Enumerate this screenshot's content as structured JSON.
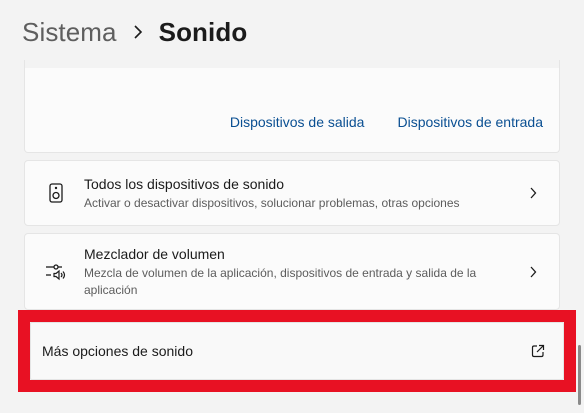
{
  "breadcrumb": {
    "parent": "Sistema",
    "current": "Sonido"
  },
  "device_links": {
    "output": "Dispositivos de salida",
    "input": "Dispositivos de entrada"
  },
  "rows": {
    "all_devices": {
      "title": "Todos los dispositivos de sonido",
      "subtitle": "Activar o desactivar dispositivos, solucionar problemas, otras opciones",
      "icon": "speaker-icon"
    },
    "mixer": {
      "title": "Mezclador de volumen",
      "subtitle": "Mezcla de volumen de la aplicación, dispositivos de entrada y salida de la aplicación",
      "icon": "volume-mixer-icon"
    },
    "more_options": {
      "title": "Más opciones de sonido",
      "icon": "open-external-icon"
    }
  },
  "colors": {
    "highlight": "#e81123",
    "link": "#0a4f92",
    "background": "#f3f3f3",
    "card": "#fbfbfb"
  }
}
